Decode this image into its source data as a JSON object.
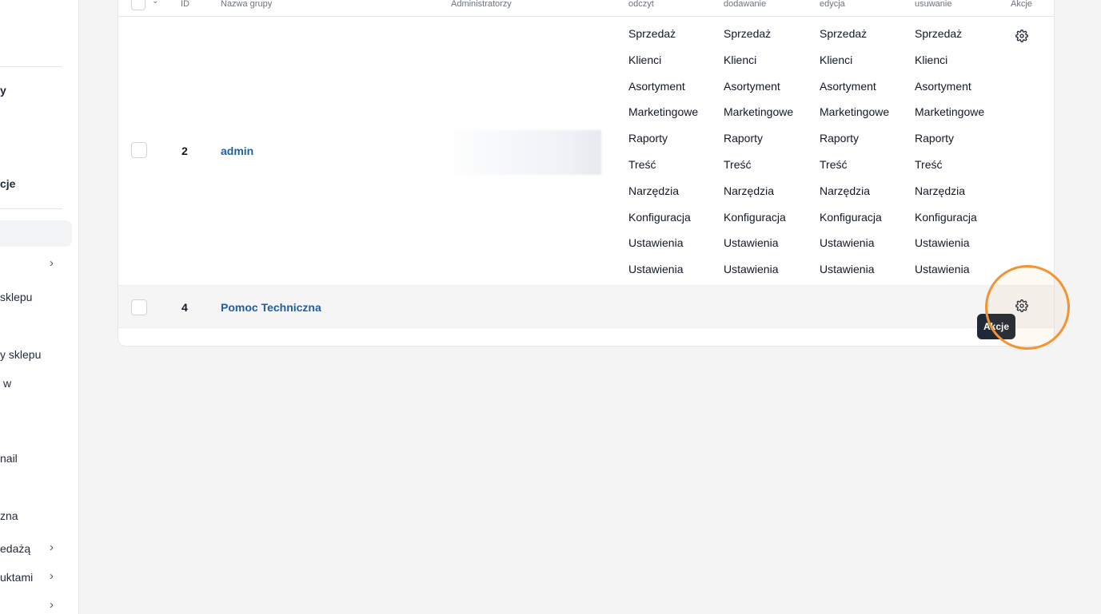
{
  "sidebar": {
    "items": [
      {
        "label": "y"
      },
      {
        "label": "cje"
      },
      {
        "label": "sklepu"
      },
      {
        "label": "y sklepu"
      },
      {
        "label": "w"
      },
      {
        "label": "nail"
      },
      {
        "label": "zna"
      },
      {
        "label": "edażą"
      },
      {
        "label": "uktami"
      }
    ]
  },
  "table": {
    "headers": {
      "id": "ID",
      "name": "Nazwa grupy",
      "admins": "Administratorzy",
      "read": "odczyt",
      "add": "dodawanie",
      "edit": "edycja",
      "delete": "usuwanie",
      "actions": "Akcje"
    },
    "rows": [
      {
        "id": "2",
        "name": "admin",
        "permissions": {
          "read": [
            "Sprzedaż",
            "Klienci",
            "Asortyment",
            "Marketingowe",
            "Raporty",
            "Treść",
            "Narzędzia",
            "Konfiguracja",
            "Ustawienia",
            "Ustawienia"
          ],
          "add": [
            "Sprzedaż",
            "Klienci",
            "Asortyment",
            "Marketingowe",
            "Raporty",
            "Treść",
            "Narzędzia",
            "Konfiguracja",
            "Ustawienia",
            "Ustawienia"
          ],
          "edit": [
            "Sprzedaż",
            "Klienci",
            "Asortyment",
            "Marketingowe",
            "Raporty",
            "Treść",
            "Narzędzia",
            "Konfiguracja",
            "Ustawienia",
            "Ustawienia"
          ],
          "delete": [
            "Sprzedaż",
            "Klienci",
            "Asortyment",
            "Marketingowe",
            "Raporty",
            "Treść",
            "Narzędzia",
            "Konfiguracja",
            "Ustawienia",
            "Ustawienia"
          ]
        }
      },
      {
        "id": "4",
        "name": "Pomoc Techniczna"
      }
    ]
  },
  "tooltip": {
    "label": "Akcje"
  },
  "icons": {
    "actions": "gear-icon",
    "expand": "chevron-right-icon",
    "sort": "chevron-down-icon"
  },
  "colors": {
    "link": "#1d5ea8",
    "highlight": "#f39331",
    "tooltip_bg": "#1f2937"
  }
}
